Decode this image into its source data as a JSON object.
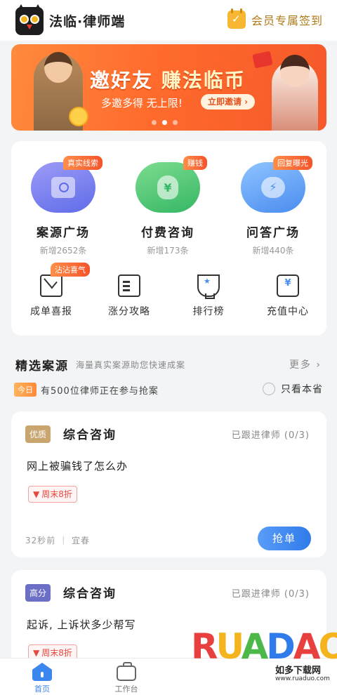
{
  "header": {
    "app_title": "法临·律师端",
    "signin_label": "会员专属签到"
  },
  "banner": {
    "headline_a": "邀好友",
    "headline_b": "赚法临币",
    "subtitle": "多邀多得 无上限!",
    "invite_label": "立即邀请 ›",
    "slides": 3,
    "active_slide": 2
  },
  "services": [
    {
      "name": "案源广场",
      "tag": "真实线索",
      "count": "新增2652条",
      "icon": "search-card-icon",
      "color": "#5f6ce8"
    },
    {
      "name": "付费咨询",
      "tag": "赚钱",
      "count": "新增173条",
      "icon": "money-bag-icon",
      "color": "#35b765"
    },
    {
      "name": "问答广场",
      "tag": "回复曝光",
      "count": "新增440条",
      "icon": "chat-bubble-icon",
      "color": "#4a8cf0"
    }
  ],
  "tools": [
    {
      "label": "成单喜报",
      "badge": "沾沾喜气",
      "icon": "envelope-icon"
    },
    {
      "label": "涨分攻略",
      "icon": "document-icon"
    },
    {
      "label": "排行榜",
      "icon": "trophy-icon"
    },
    {
      "label": "充值中心",
      "icon": "wallet-icon"
    }
  ],
  "featured": {
    "title": "精选案源",
    "description": "海量真实案源助您快速成案",
    "more_label": "更多",
    "notice_tag": "今日",
    "notice_text": "有500位律师正在参与抢案",
    "local_only_label": "只看本省",
    "local_only_checked": false
  },
  "cases": [
    {
      "level": "优质",
      "level_color": "#c9a56f",
      "type": "综合咨询",
      "follow": "已跟进律师 (0/3)",
      "question": "网上被骗钱了怎么办",
      "discount": "周末8折",
      "time": "32秒前",
      "city": "宜春",
      "action": "抢单"
    },
    {
      "level": "高分",
      "level_color": "#6c6fc6",
      "type": "综合咨询",
      "follow": "已跟进律师 (0/3)",
      "question": "起诉, 上诉状多少帮写",
      "discount": "周末8折"
    }
  ],
  "tabbar": {
    "home_label": "首页",
    "work_label": "工作台",
    "active": "home"
  },
  "watermark": {
    "letters": [
      "R",
      "U",
      "A",
      "D",
      "A",
      "O"
    ],
    "cn_text": "如多下载网",
    "url": "www.ruaduo.com"
  }
}
